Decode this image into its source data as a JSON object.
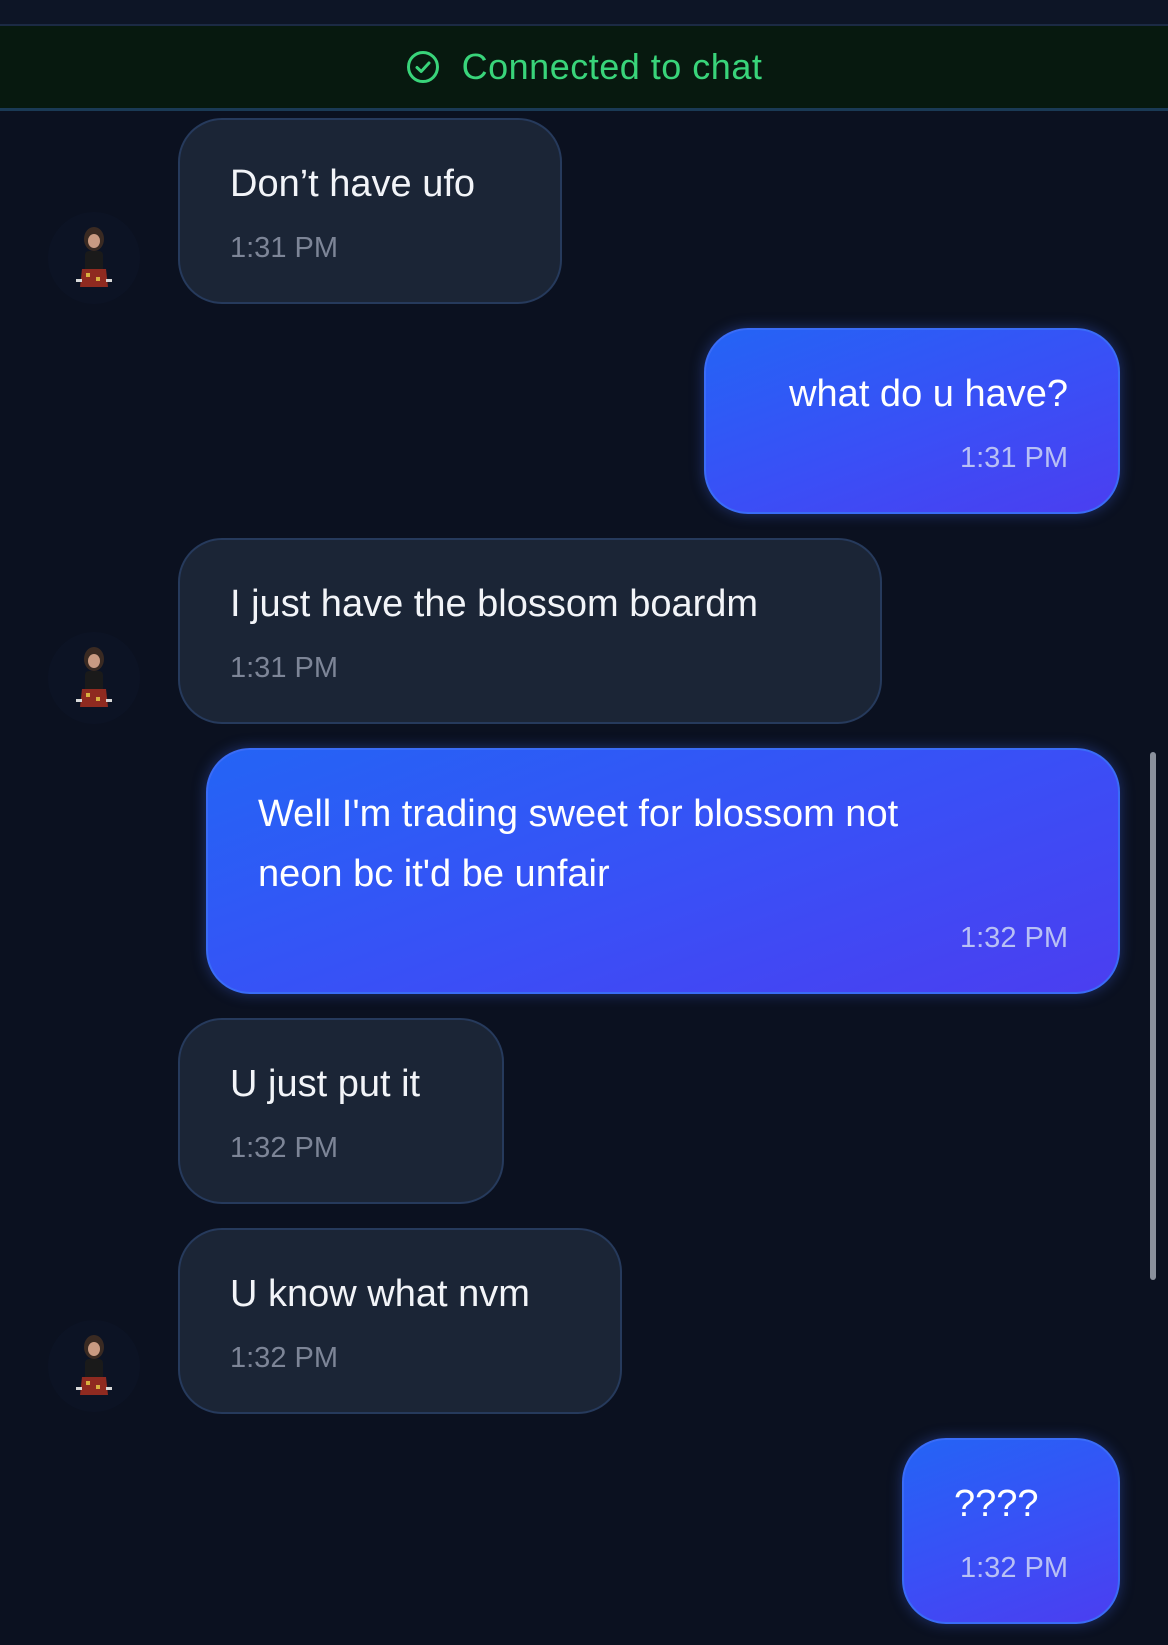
{
  "status_banner": {
    "text": "Connected to chat",
    "icon": "check-circle-icon",
    "color": "#39d47a"
  },
  "colors": {
    "incoming_bubble": "#1b2536",
    "outgoing_bubble": "#3a4ff6",
    "background": "#0b1120"
  },
  "messages": [
    {
      "direction": "incoming",
      "text": "Don’t have ufo",
      "time": "1:31 PM",
      "avatar": true
    },
    {
      "direction": "outgoing",
      "text": "what do u have?",
      "time": "1:31 PM"
    },
    {
      "direction": "incoming",
      "text": "I just have the blossom boardm",
      "time": "1:31 PM",
      "avatar": true
    },
    {
      "direction": "outgoing",
      "text_lines": [
        "Well I'm trading sweet for blossom not",
        "neon bc it'd be unfair"
      ],
      "time": "1:32 PM"
    },
    {
      "direction": "incoming",
      "text": "U just put it",
      "time": "1:32 PM"
    },
    {
      "direction": "incoming",
      "text": "U know what nvm",
      "time": "1:32 PM",
      "avatar": true
    },
    {
      "direction": "outgoing",
      "text": "????",
      "time": "1:32 PM"
    }
  ]
}
